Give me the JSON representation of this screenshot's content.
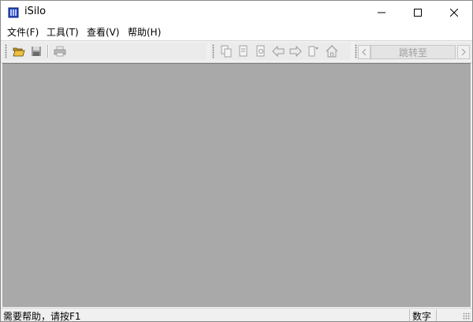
{
  "window": {
    "title": "iSilo",
    "app_icon": "isilo-book-icon",
    "controls": {
      "minimize_icon": "minimize-icon",
      "maximize_icon": "maximize-icon",
      "close_icon": "close-icon"
    }
  },
  "menu": {
    "items": [
      {
        "label": "文件(F)"
      },
      {
        "label": "工具(T)"
      },
      {
        "label": "查看(V)"
      },
      {
        "label": "帮助(H)"
      }
    ]
  },
  "toolbar": {
    "file_buttons": [
      "open-folder-icon",
      "save-icon",
      "print-icon"
    ],
    "nav_buttons": [
      "copy-icon",
      "document-icon",
      "document-alt-icon",
      "back-arrow-icon",
      "forward-arrow-icon",
      "bookmark-icon",
      "home-icon"
    ],
    "jump_label": "跳转至",
    "prev_icon": "chevron-left-icon",
    "next_icon": "chevron-right-icon"
  },
  "statusbar": {
    "help_text": "需要帮助，请按F1",
    "num_lock": "数字"
  },
  "colors": {
    "content_bg": "#a9a9a9",
    "chrome_bg": "#f0f0f0",
    "titlebar_bg": "#ffffff"
  }
}
